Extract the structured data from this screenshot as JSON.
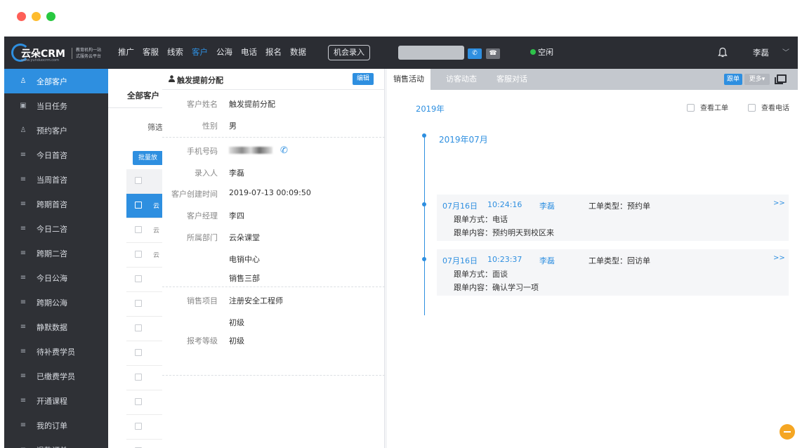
{
  "window": {
    "traffic_lights": [
      "#fe5f57",
      "#febc2e",
      "#28c840"
    ]
  },
  "brand": {
    "name": "云朵CRM",
    "url": "www.yunduocrm.com",
    "tagline_1": "教育机构一站",
    "tagline_2": "式服务云平台"
  },
  "nav": {
    "items": [
      "推广",
      "客服",
      "线索",
      "客户",
      "公海",
      "电话",
      "报名",
      "数据"
    ],
    "active_item": "客户",
    "opportunity_button": "机会录入",
    "status": "空闲",
    "user": "李磊",
    "accent": "#2e8fe0"
  },
  "sidebar": {
    "items": [
      {
        "icon": "person-outline-icon",
        "label": "全部客户"
      },
      {
        "icon": "calendar-check-icon",
        "label": "当日任务"
      },
      {
        "icon": "person-outline-icon",
        "label": "预约客户"
      },
      {
        "icon": "list-search-icon",
        "label": "今日首咨"
      },
      {
        "icon": "list-search-icon",
        "label": "当周首咨"
      },
      {
        "icon": "list-search-icon",
        "label": "跨期首咨"
      },
      {
        "icon": "list-search-icon",
        "label": "今日二咨"
      },
      {
        "icon": "list-search-icon",
        "label": "跨期二咨"
      },
      {
        "icon": "list-search-icon",
        "label": "今日公海"
      },
      {
        "icon": "list-search-icon",
        "label": "跨期公海"
      },
      {
        "icon": "list-search-icon",
        "label": "静默数据"
      },
      {
        "icon": "list-search-icon",
        "label": "待补费学员"
      },
      {
        "icon": "list-search-icon",
        "label": "已缴费学员"
      },
      {
        "icon": "list-search-icon",
        "label": "开通课程"
      },
      {
        "icon": "list-search-icon",
        "label": "我的订单"
      },
      {
        "icon": "list-search-icon",
        "label": "退款订单"
      }
    ],
    "active_index": 0
  },
  "list": {
    "title": "全部客户",
    "filter_label": "筛选",
    "batch_button": "批量放",
    "row_cell_text": [
      "云",
      "云",
      "云"
    ]
  },
  "detail": {
    "title": "触发提前分配",
    "edit_button": "编辑",
    "fields": {
      "name_label": "客户姓名",
      "name": "触发提前分配",
      "gender_label": "性别",
      "gender": "男",
      "phone_label": "手机号码",
      "entered_by_label": "录入人",
      "entered_by": "李磊",
      "created_label": "客户创建时间",
      "created": "2019-07-13 00:09:50",
      "manager_label": "客户经理",
      "manager": "李四",
      "dept_label": "所属部门",
      "dept_1": "云朵课堂",
      "dept_2": "电销中心",
      "dept_3": "销售三部",
      "project_label": "销售项目",
      "project": "注册安全工程师",
      "project_level": "初级",
      "exam_level_label": "报考等级",
      "exam_level": "初级"
    }
  },
  "activity": {
    "tabs": [
      "销售活动",
      "访客动态",
      "客服对话"
    ],
    "active_tab": 0,
    "follow_button": "跟单",
    "more_button": "更多▾",
    "year": "2019年",
    "check_work_order": "查看工单",
    "check_calls": "查看电话",
    "month": "2019年07月",
    "entries": [
      {
        "date": "07月16日",
        "time": "10:24:16",
        "person": "李磊",
        "type": "工单类型：预约单",
        "method": "跟单方式：电话",
        "content": "跟单内容：预约明天到校区来",
        "arrow": ">>"
      },
      {
        "date": "07月16日",
        "time": "10:23:37",
        "person": "李磊",
        "type": "工单类型：回访单",
        "method": "跟单方式：面谈",
        "content": "跟单内容：确认学习一项",
        "arrow": ">>"
      }
    ]
  }
}
